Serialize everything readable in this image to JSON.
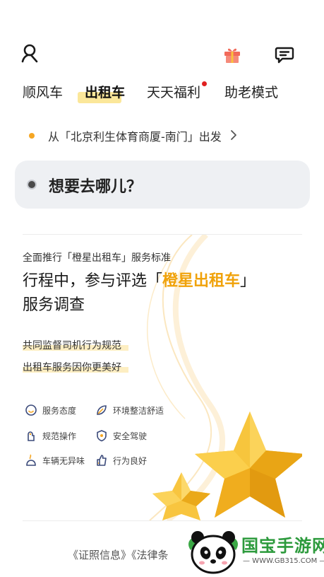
{
  "header": {
    "icons": [
      "profile-icon",
      "gift-icon",
      "message-icon"
    ]
  },
  "tabs": [
    {
      "label": "顺风车",
      "active": false
    },
    {
      "label": "出租车",
      "active": true
    },
    {
      "label": "天天福利",
      "active": false,
      "badge_dot": true
    },
    {
      "label": "助老模式",
      "active": false
    }
  ],
  "origin": {
    "text": "从「北京利生体育商厦-南门」出发"
  },
  "search": {
    "placeholder": "想要去哪儿？"
  },
  "banner": {
    "subtitle": "全面推行「橙星出租车」服务标准",
    "title_prefix": "行程中，参与评选「",
    "title_highlight": "橙星出租车",
    "title_suffix": "」",
    "title_line2": "服务调查",
    "line1": "共同监督司机行为规范",
    "line2": "出租车服务因你更美好",
    "features": [
      {
        "label": "服务态度",
        "icon": "smile-icon"
      },
      {
        "label": "环境整洁舒适",
        "icon": "leaf-icon"
      },
      {
        "label": "规范操作",
        "icon": "hand-icon"
      },
      {
        "label": "安全驾驶",
        "icon": "shield-icon"
      },
      {
        "label": "车辆无异味",
        "icon": "fragrance-icon"
      },
      {
        "label": "行为良好",
        "icon": "thumb-icon"
      }
    ]
  },
  "footer": {
    "links_text": "《证照信息》《法律条"
  },
  "watermark": {
    "name": "国宝手游网",
    "url": "— WWW.GB315.COM —"
  },
  "colors": {
    "accent_yellow": "#fbe79a",
    "star_orange": "#f0a20a",
    "badge_red": "#e02020",
    "search_bg": "#eef0f3"
  }
}
